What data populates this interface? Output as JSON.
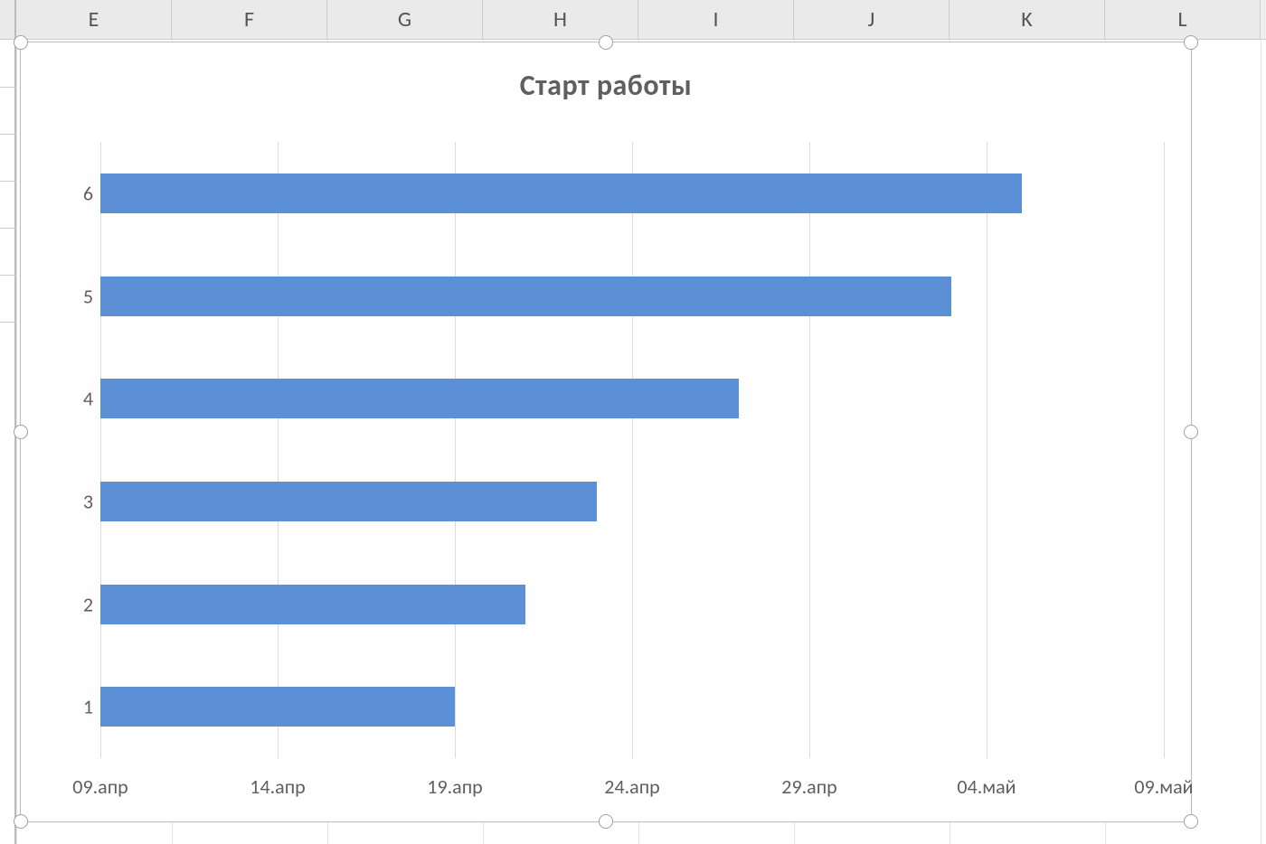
{
  "columns": [
    "E",
    "F",
    "G",
    "H",
    "I",
    "J",
    "K",
    "L"
  ],
  "chart_data": {
    "type": "bar",
    "orientation": "horizontal",
    "title": "Старт работы",
    "categories": [
      "1",
      "2",
      "3",
      "4",
      "5",
      "6"
    ],
    "x_ticks": [
      "09.апр",
      "14.апр",
      "19.апр",
      "24.апр",
      "29.апр",
      "04.май",
      "09.май"
    ],
    "x_tick_values": [
      0,
      5,
      10,
      15,
      20,
      25,
      30
    ],
    "x_range": [
      0,
      30
    ],
    "values": [
      10,
      12,
      14,
      18,
      24,
      26
    ],
    "value_labels": [
      "19.апр",
      "21.апр",
      "23.апр",
      "27.апр",
      "03.май",
      "05.май"
    ],
    "bar_color": "#5B8FD6",
    "xlabel": "",
    "ylabel": ""
  }
}
